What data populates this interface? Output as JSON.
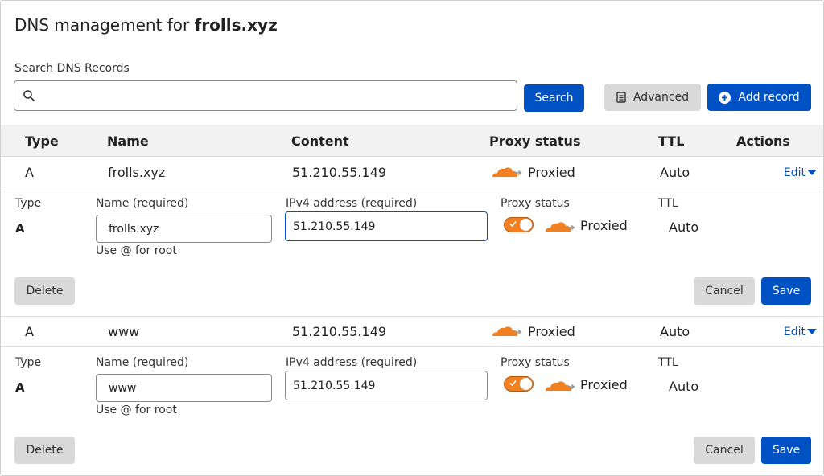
{
  "header": {
    "title_prefix": "DNS management for ",
    "domain": "frolls.xyz"
  },
  "search": {
    "label": "Search DNS Records",
    "placeholder": "",
    "value": "",
    "button": "Search"
  },
  "toolbar": {
    "advanced": "Advanced",
    "add_record": "Add record"
  },
  "table": {
    "headers": {
      "type": "Type",
      "name": "Name",
      "content": "Content",
      "proxy": "Proxy status",
      "ttl": "TTL",
      "actions": "Actions"
    }
  },
  "records": [
    {
      "type": "A",
      "name": "frolls.xyz",
      "content": "51.210.55.149",
      "proxy": "Proxied",
      "ttl": "Auto",
      "edit": "Edit",
      "form": {
        "type_label": "Type",
        "type_value": "A",
        "name_label": "Name (required)",
        "name_value": "frolls.xyz",
        "name_hint": "Use @ for root",
        "ip_label": "IPv4 address (required)",
        "ip_value": "51.210.55.149",
        "proxy_label": "Proxy status",
        "proxy_value": "Proxied",
        "ttl_label": "TTL",
        "ttl_value": "Auto",
        "delete": "Delete",
        "cancel": "Cancel",
        "save": "Save"
      }
    },
    {
      "type": "A",
      "name": "www",
      "content": "51.210.55.149",
      "proxy": "Proxied",
      "ttl": "Auto",
      "edit": "Edit",
      "form": {
        "type_label": "Type",
        "type_value": "A",
        "name_label": "Name (required)",
        "name_value": "www",
        "name_hint": "Use @ for root",
        "ip_label": "IPv4 address (required)",
        "ip_value": "51.210.55.149",
        "proxy_label": "Proxy status",
        "proxy_value": "Proxied",
        "ttl_label": "TTL",
        "ttl_value": "Auto",
        "delete": "Delete",
        "cancel": "Cancel",
        "save": "Save"
      }
    }
  ],
  "icons": {
    "search": "search-icon",
    "advanced": "document-icon",
    "add": "plus-circle-icon",
    "proxy": "orange-cloud-icon",
    "edit": "caret-down-icon",
    "toggle": "check-icon"
  },
  "colors": {
    "accent": "#0051c3",
    "proxy_orange": "#f38020",
    "button_grey": "#d9d9d9"
  }
}
